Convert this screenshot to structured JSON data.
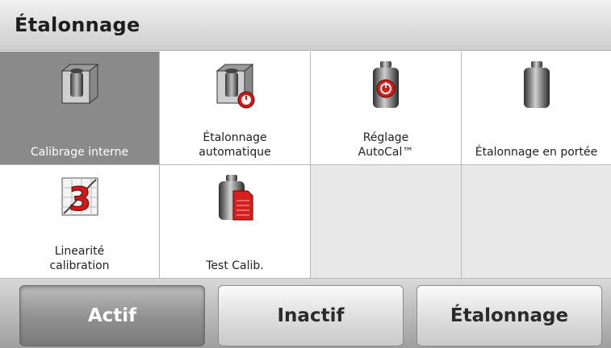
{
  "header": {
    "title": "Étalonnage"
  },
  "grid": {
    "items": [
      {
        "label": "Calibrage interne",
        "icon": "weight-cube-icon",
        "selected": true
      },
      {
        "label": "Étalonnage\nautomatique",
        "icon": "weight-cube-clock-icon"
      },
      {
        "label": "Réglage\nAutoCal™",
        "icon": "weight-red-power-icon"
      },
      {
        "label": "Étalonnage en portée",
        "icon": "weight-gray-icon"
      },
      {
        "label": "Linearité\ncalibration",
        "icon": "linearity-3-chart-icon"
      },
      {
        "label": "Test Calib.",
        "icon": "weight-red-document-icon"
      }
    ]
  },
  "footer": {
    "buttons": [
      {
        "label": "Actif",
        "active": true
      },
      {
        "label": "Inactif"
      },
      {
        "label": "Étalonnage"
      }
    ]
  },
  "colors": {
    "selected": "#8a8a8a",
    "accent_red": "#cc1a1a",
    "weight_gray": "#5a5a5a"
  }
}
